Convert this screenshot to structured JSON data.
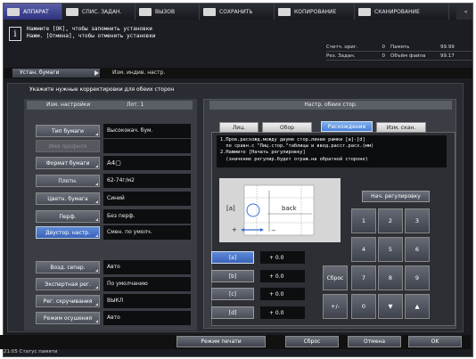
{
  "tabs": [
    {
      "label": "АППАРАТ"
    },
    {
      "label": "СПИС. ЗАДАН."
    },
    {
      "label": "ВЫЗОВ"
    },
    {
      "label": "СОХРАНИТЬ"
    },
    {
      "label": "КОПИРОВАНИЕ"
    },
    {
      "label": "СКАНИРОВАНИЕ"
    }
  ],
  "message": {
    "line1": "Нажмите [OK], чтобы запомнить установки",
    "line2": "Нажм. [Отмена], чтобы отменить установки"
  },
  "counter": {
    "row1_label": "Счетч. ориг.",
    "row1_value": "0",
    "row1_label2": "Память",
    "row1_value2": "99.99",
    "row2_label": "Рез. Задан.",
    "row2_value": "0",
    "row2_label2": "Объём файла",
    "row2_value2": "99.17"
  },
  "breadcrumb": {
    "item1": "Устан. бумаги",
    "item2": "Изм. индив. настр."
  },
  "panel": {
    "title": "Укажите нужные корректировки для обеих сторон"
  },
  "left": {
    "head_label": "Изм. настройки",
    "head_value": "Лот. 1",
    "rows": [
      {
        "label": "Тип бумаги",
        "value": "Высококач. бум."
      },
      {
        "label": "Имя профиля",
        "value": ""
      },
      {
        "label": "Формат бумаги",
        "value": "A4▢"
      },
      {
        "label": "Плотн.",
        "value": "62-74г/м2"
      },
      {
        "label": "Цветн. бумага",
        "value": "Синий"
      },
      {
        "label": "Перф.",
        "value": "Без перф."
      },
      {
        "label": "Двустор. настр.",
        "value": "Смен. по умолч."
      }
    ],
    "rows2": [
      {
        "label": "Возд. сепар.",
        "value": "Авто"
      },
      {
        "label": "Экспертная рег.",
        "value": "По умолчанию"
      },
      {
        "label": "Рег. скручивания",
        "value": "ВЫКЛ"
      },
      {
        "label": "Режим осушения",
        "value": "Авто"
      }
    ]
  },
  "right": {
    "head": "Настр. обеих стор.",
    "tabs": [
      "Лиц.",
      "Обор",
      "Расхождение",
      "Изм. скан."
    ],
    "instructions": "1.Пров.расхожд.между двумя стор.линии рамки [a]-[d]\n  по сравн.с \"Лиц.стор.\"таблицы и введ.расст.расх.(мм)\n2.Нажмите [Начать регулировку]\n  (значение регулир.будет отраж.на обратной стороне)",
    "adjust_start": "Нач. регулировку",
    "diagram": {
      "a_label": "[a]",
      "back_label": "back"
    },
    "sides": [
      {
        "label": "[a]",
        "value": "+ 0.0"
      },
      {
        "label": "[b]",
        "value": "+ 0.0"
      },
      {
        "label": "[c]",
        "value": "+ 0.0"
      },
      {
        "label": "[d]",
        "value": "+ 0.0"
      }
    ],
    "keys": [
      "1",
      "2",
      "3",
      "4",
      "5",
      "6",
      "7",
      "8",
      "9",
      "0"
    ],
    "reset_key": "Сброс",
    "sign_key": "+/-",
    "down_key": "▼",
    "up_key": "▲"
  },
  "bottom": {
    "print_mode": "Режим печати",
    "reset": "Сброс",
    "cancel": "Отмена",
    "ok": "OK"
  },
  "status": "21:05  Статус памяти"
}
